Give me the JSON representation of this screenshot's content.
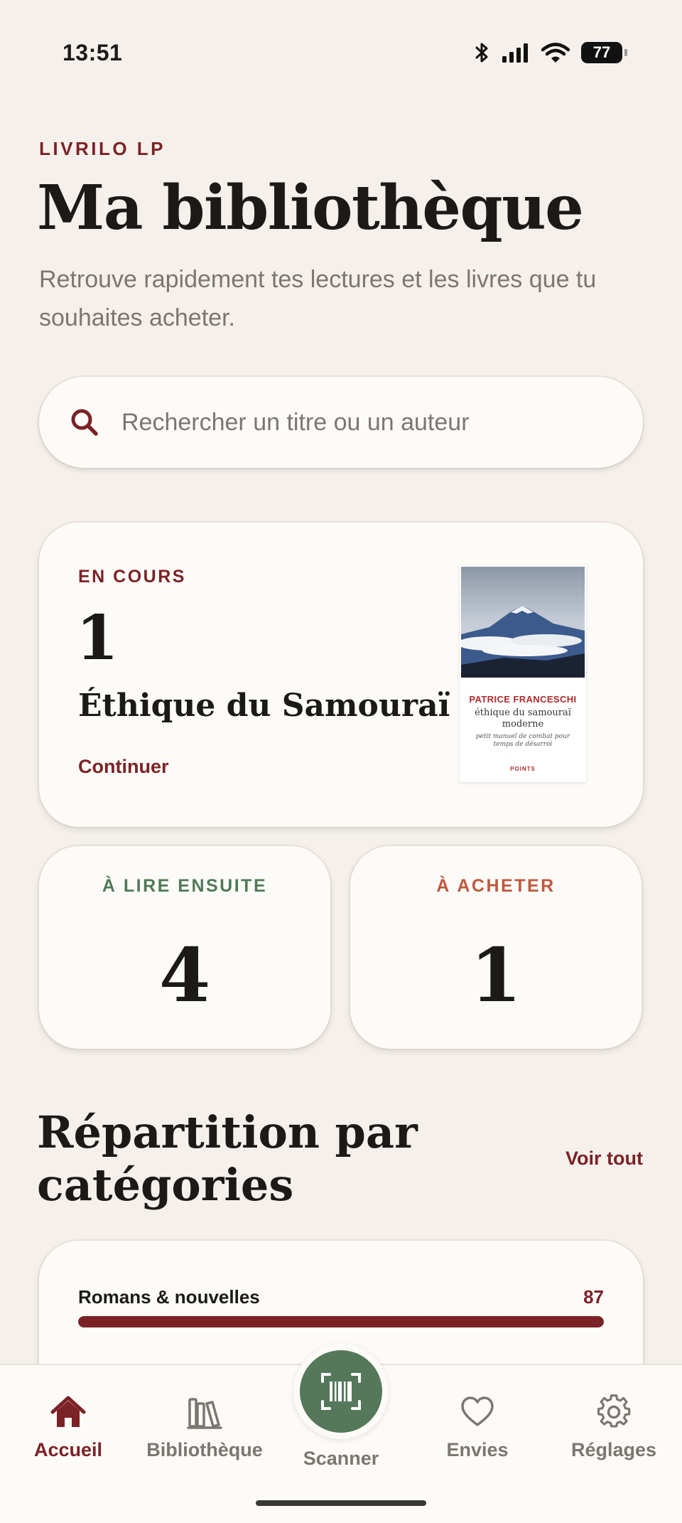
{
  "status_bar": {
    "time": "13:51",
    "battery": "77"
  },
  "header": {
    "eyebrow": "LIVRILO LP",
    "title": "Ma bibliothèque",
    "subtitle": "Retrouve rapidement tes lectures et les livres que tu souhaites acheter."
  },
  "search": {
    "placeholder": "Rechercher un titre ou un auteur",
    "value": ""
  },
  "current_reading": {
    "label": "EN COURS",
    "count": "1",
    "title": "Éthique du Samouraï ...",
    "action": "Continuer",
    "cover": {
      "author": "PATRICE FRANCESCHI",
      "title": "éthique du samouraï moderne",
      "subtitle": "petit manuel de combat pour temps de désarroi",
      "publisher": "POINTS"
    }
  },
  "stats": {
    "to_read_next": {
      "label": "À LIRE ENSUITE",
      "value": "4",
      "color": "#4f7a58"
    },
    "to_buy": {
      "label": "À ACHETER",
      "value": "1",
      "color": "#c0583d"
    }
  },
  "categories_section": {
    "title": "Répartition par catégories",
    "see_all": "Voir tout",
    "items": [
      {
        "name": "Romans & nouvelles",
        "count": "87",
        "fraction": 1.0,
        "color": "#7b2227"
      }
    ]
  },
  "nav": {
    "home": "Accueil",
    "library": "Bibliothèque",
    "scanner": "Scanner",
    "wishlist": "Envies",
    "settings": "Réglages",
    "active": "home"
  },
  "colors": {
    "accent": "#7b2227",
    "green": "#55785a",
    "background": "#f5f0eb",
    "card": "#fdfbf8",
    "muted": "#7b7670"
  }
}
